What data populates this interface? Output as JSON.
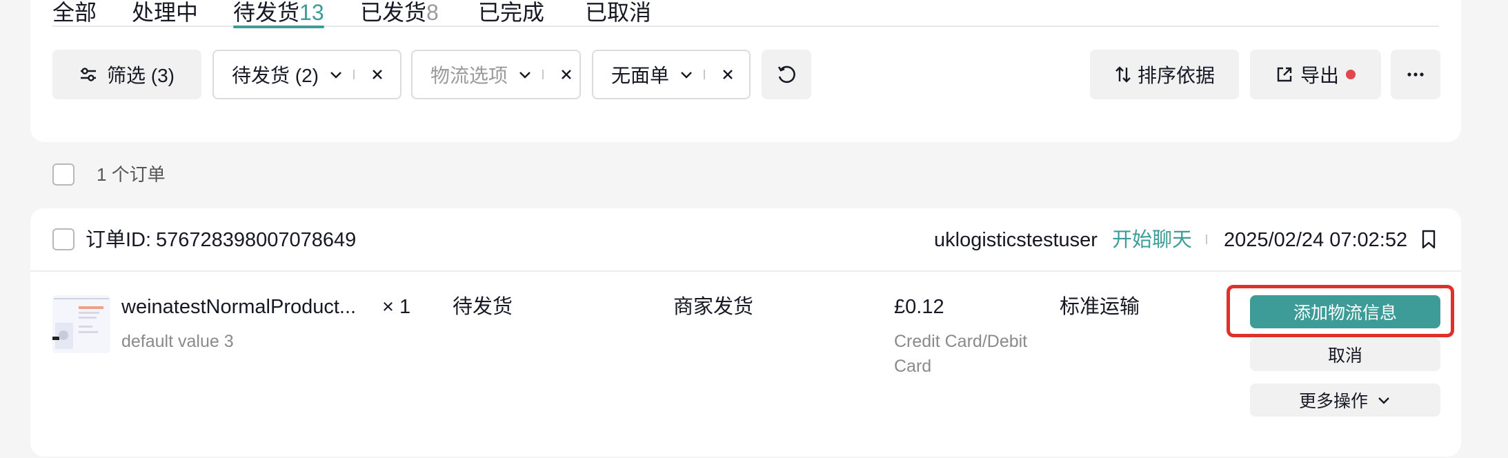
{
  "tabs": [
    {
      "label": "全部",
      "count": ""
    },
    {
      "label": "处理中",
      "count": ""
    },
    {
      "label": "待发货",
      "count": "13"
    },
    {
      "label": "已发货",
      "count": "8"
    },
    {
      "label": "已完成",
      "count": ""
    },
    {
      "label": "已取消",
      "count": ""
    }
  ],
  "toolbar": {
    "filter_label": "筛选 (3)",
    "chip_status": "待发货 (2)",
    "chip_logistics_placeholder": "物流选项",
    "chip_waybill": "无面单",
    "sort_label": "排序依据",
    "export_label": "导出"
  },
  "summary": {
    "order_count": "1 个订单"
  },
  "order": {
    "id_label": "订单ID:",
    "id": "576728398007078649",
    "buyer": "uklogisticstestuser",
    "chat_label": "开始聊天",
    "date": "2025/02/24 07:02:52",
    "product_name": "weinatestNormalProduct...",
    "variant": "default value 3",
    "quantity": "× 1",
    "status": "待发货",
    "fulfillment": "商家发货",
    "price": "£0.12",
    "payment_line1": "Credit Card/Debit",
    "payment_line2": "Card",
    "shipping": "标准运输",
    "actions": {
      "add_logistics": "添加物流信息",
      "cancel": "取消",
      "more": "更多操作"
    }
  },
  "colors": {
    "accent": "#3d9b98",
    "highlight": "#e0302a",
    "export_dot": "#e0484d"
  }
}
